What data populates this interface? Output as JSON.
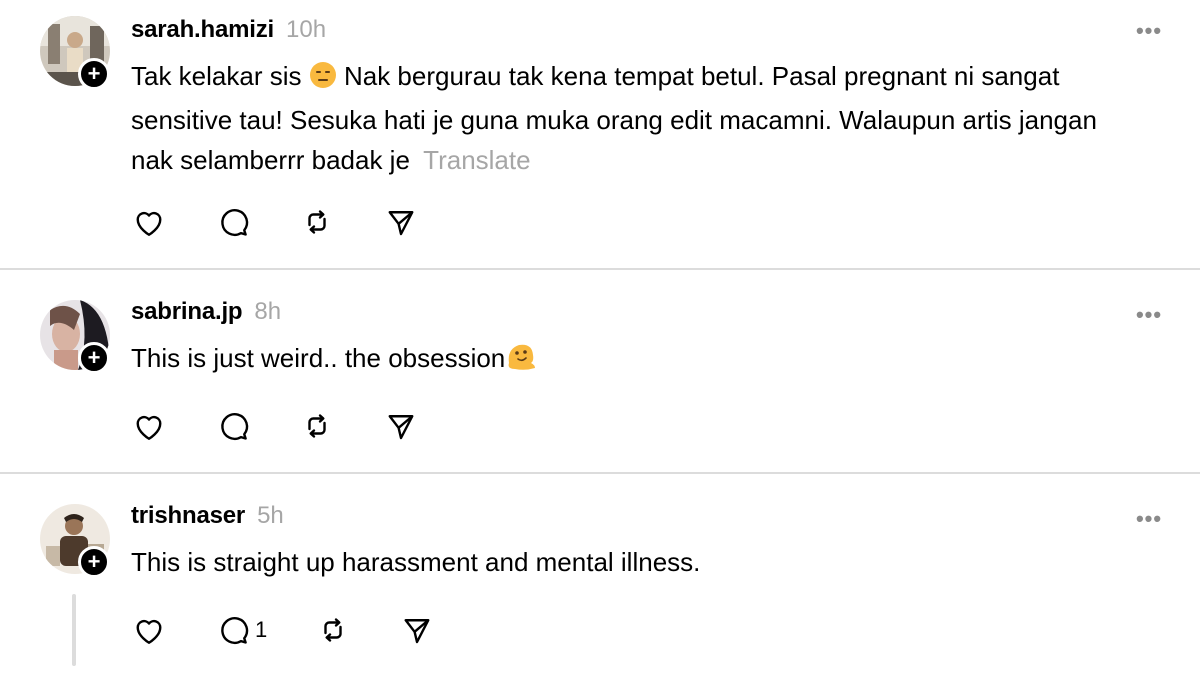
{
  "posts": [
    {
      "username": "sarah.hamizi",
      "time": "10h",
      "text_before_emoji": "Tak kelakar sis ",
      "emoji": "expressionless-face",
      "text_after_emoji": " Nak bergurau tak kena tempat betul. Pasal pregnant ni sangat sensitive tau! Sesuka hati je guna muka orang edit macamni. Walaupun artis jangan nak selamberrr badak je",
      "translate_label": "Translate",
      "reply_count": ""
    },
    {
      "username": "sabrina.jp",
      "time": "8h",
      "text_before_emoji": "This is just weird.. the obsession",
      "emoji": "melting-face",
      "text_after_emoji": "",
      "reply_count": ""
    },
    {
      "username": "trishnaser",
      "time": "5h",
      "text_before_emoji": "This is straight up harassment and mental illness.",
      "emoji": "",
      "text_after_emoji": "",
      "reply_count": "1"
    }
  ],
  "icons": {
    "like": "heart-icon",
    "reply": "comment-icon",
    "repost": "repost-icon",
    "share": "send-icon",
    "more": "more-icon",
    "follow": "plus-icon"
  },
  "colors": {
    "text": "#000000",
    "muted": "#a6a6a6",
    "divider": "#dcdcdc"
  }
}
